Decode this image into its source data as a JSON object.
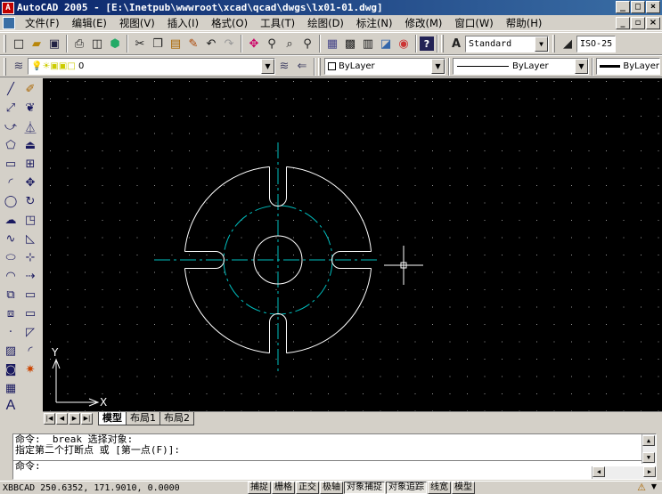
{
  "window": {
    "title": "AutoCAD 2005 - [E:\\Inetpub\\wwwroot\\xcad\\qcad\\dwgs\\lx01-01.dwg]",
    "app_icon": "autocad-logo-icon",
    "minimize": "_",
    "maximize": "□",
    "close": "×",
    "doc_minimize": "_",
    "doc_restore": "▫",
    "doc_close": "×"
  },
  "menu": {
    "items": [
      "文件(F)",
      "编辑(E)",
      "视图(V)",
      "插入(I)",
      "格式(O)",
      "工具(T)",
      "绘图(D)",
      "标注(N)",
      "修改(M)",
      "窗口(W)",
      "帮助(H)"
    ]
  },
  "toolbar1": {
    "buttons": [
      "new-icon",
      "open-icon",
      "save-icon",
      "print-icon",
      "preview-icon",
      "publish-icon",
      "cut-icon",
      "copy-icon",
      "paste-icon",
      "matchprop-icon",
      "undo-icon",
      "redo-icon",
      "pan-icon",
      "zoom-realtime-icon",
      "zoom-window-icon",
      "zoom-previous-icon",
      "properties-icon",
      "designcenter-icon",
      "toolpalettes-icon",
      "sheetset-icon",
      "markup-icon",
      "help-icon"
    ],
    "text_style": "Standard",
    "dim_style": "ISO-25"
  },
  "toolbar2": {
    "layer": "0",
    "color": "ByLayer",
    "linetype": "ByLayer",
    "lineweight": "ByLayer"
  },
  "left_tools": {
    "draw": [
      "line-icon",
      "construction-line-icon",
      "polyline-icon",
      "polygon-icon",
      "rectangle-icon",
      "arc-icon",
      "circle-icon",
      "revcloud-icon",
      "spline-icon",
      "ellipse-icon",
      "ellipse-arc-icon",
      "insert-block-icon",
      "make-block-icon",
      "point-icon",
      "hatch-icon",
      "region-icon",
      "table-icon",
      "mtext-icon"
    ],
    "mtext_label": "A",
    "modify": [
      "erase-icon",
      "copy-object-icon",
      "mirror-icon",
      "offset-icon",
      "array-icon",
      "move-icon",
      "rotate-icon",
      "scale-icon",
      "stretch-icon",
      "trim-icon",
      "extend-icon",
      "break-at-point-icon",
      "break-icon",
      "chamfer-icon",
      "fillet-icon",
      "explode-icon"
    ]
  },
  "canvas": {
    "background": "#000000",
    "geometry_color": "#ffffff",
    "centerline_color": "#00c0c0",
    "ucs_x": "X",
    "ucs_y": "Y"
  },
  "layout_tabs": {
    "tabs": [
      "模型",
      "布局1",
      "布局2"
    ],
    "active": "模型"
  },
  "command": {
    "lines": [
      "命令: _break 选择对象:",
      "指定第二个打断点 或 [第一点(F)]:"
    ],
    "prompt": "命令:"
  },
  "status": {
    "coords": "250.6352, 171.9010, 0.0000",
    "coords_prefix": "XBBCAD",
    "toggles": [
      "捕捉",
      "栅格",
      "正交",
      "极轴",
      "对象捕捉",
      "对象追踪",
      "线宽",
      "模型"
    ],
    "pressed": [
      "对象捕捉",
      "对象追踪"
    ]
  }
}
